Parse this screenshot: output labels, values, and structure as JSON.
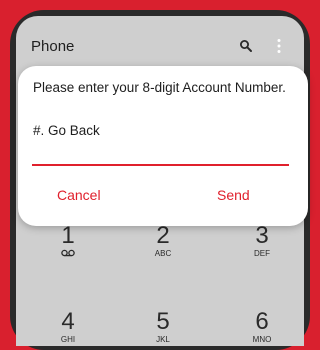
{
  "appbar": {
    "title": "Phone",
    "icons": [
      "search-icon",
      "more-vertical-icon"
    ]
  },
  "keypad": {
    "keys": [
      {
        "digit": "1",
        "letters": "",
        "icon": "voicemail-icon"
      },
      {
        "digit": "2",
        "letters": "ABC"
      },
      {
        "digit": "3",
        "letters": "DEF"
      },
      {
        "digit": "4",
        "letters": "GHI"
      },
      {
        "digit": "5",
        "letters": "JKL"
      },
      {
        "digit": "6",
        "letters": "MNO"
      }
    ]
  },
  "dialog": {
    "message": "Please enter your 8-digit Account Number.",
    "hint": "#. Go Back",
    "input_value": "",
    "cancel_label": "Cancel",
    "send_label": "Send"
  },
  "colors": {
    "background": "#d9202e",
    "accent": "#e0202c",
    "dialog": "#ffffff",
    "screen": "#cfcfcf"
  }
}
